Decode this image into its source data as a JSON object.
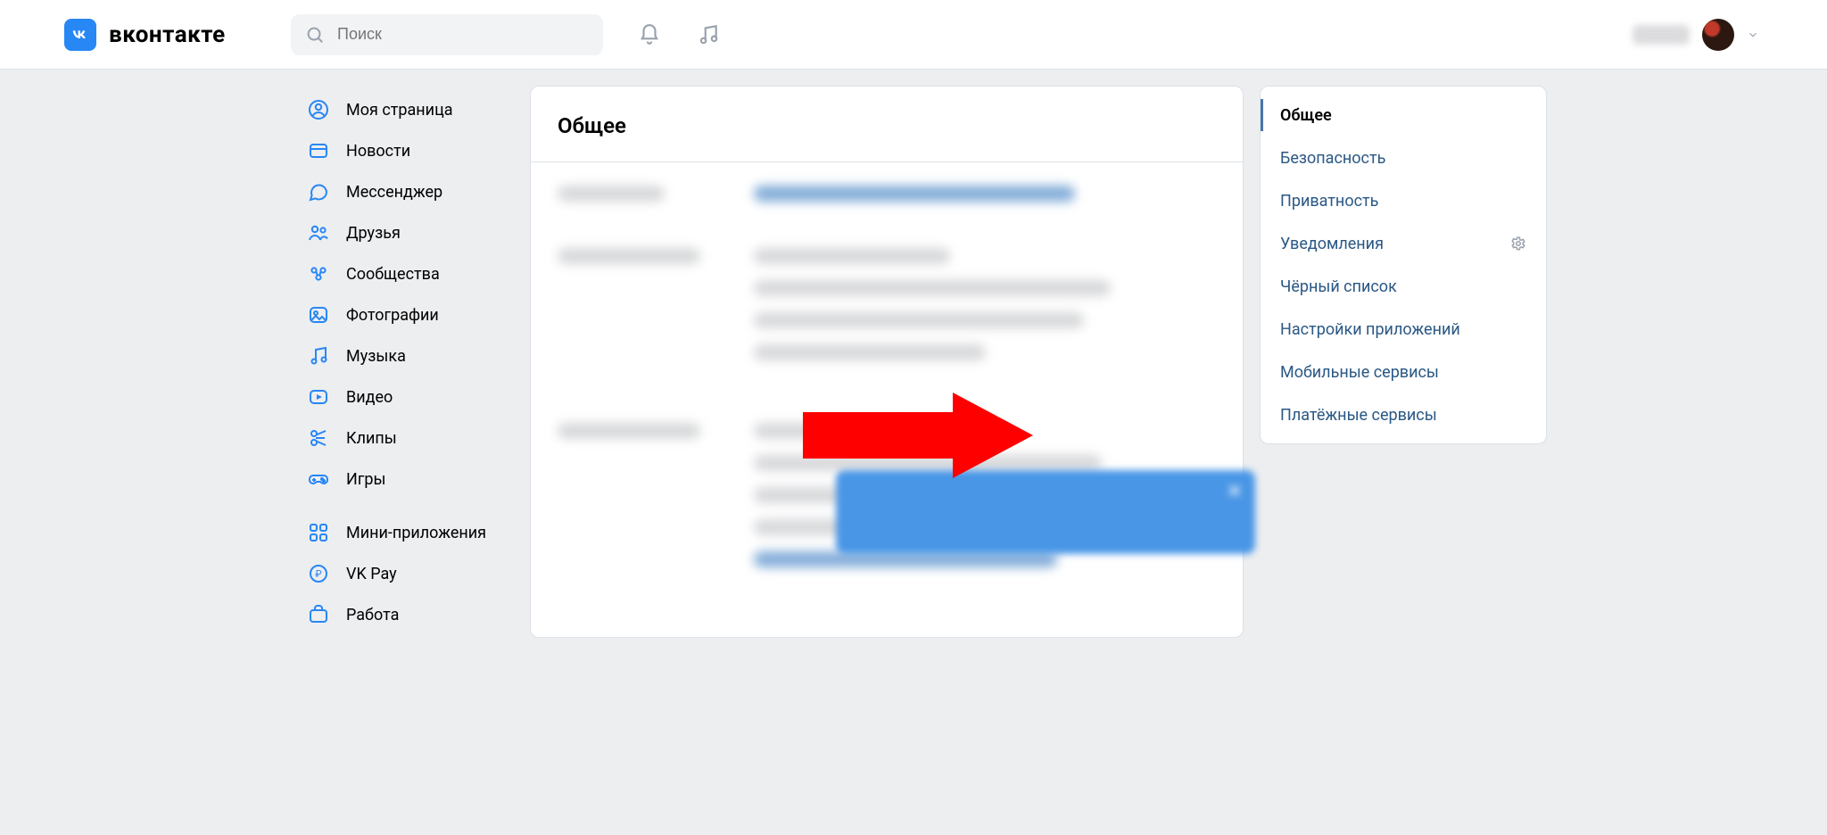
{
  "brand": {
    "name": "вконтакте",
    "logo_letters": "VK"
  },
  "search": {
    "placeholder": "Поиск"
  },
  "left_nav": [
    {
      "key": "profile",
      "label": "Моя страница"
    },
    {
      "key": "news",
      "label": "Новости"
    },
    {
      "key": "messenger",
      "label": "Мессенджер"
    },
    {
      "key": "friends",
      "label": "Друзья"
    },
    {
      "key": "communities",
      "label": "Сообщества"
    },
    {
      "key": "photos",
      "label": "Фотографии"
    },
    {
      "key": "music",
      "label": "Музыка"
    },
    {
      "key": "video",
      "label": "Видео"
    },
    {
      "key": "clips",
      "label": "Клипы"
    },
    {
      "key": "games",
      "label": "Игры"
    }
  ],
  "left_nav_extra": [
    {
      "key": "miniapps",
      "label": "Мини-приложения"
    },
    {
      "key": "vkpay",
      "label": "VK Pay"
    },
    {
      "key": "work",
      "label": "Работа"
    }
  ],
  "main": {
    "title": "Общее"
  },
  "settings_sidebar": [
    {
      "key": "general",
      "label": "Общее",
      "active": true
    },
    {
      "key": "security",
      "label": "Безопасность",
      "active": false
    },
    {
      "key": "privacy",
      "label": "Приватность",
      "active": false
    },
    {
      "key": "notifications",
      "label": "Уведомления",
      "active": false,
      "gear": true
    },
    {
      "key": "blacklist",
      "label": "Чёрный список",
      "active": false
    },
    {
      "key": "apps",
      "label": "Настройки приложений",
      "active": false
    },
    {
      "key": "mobile",
      "label": "Мобильные сервисы",
      "active": false
    },
    {
      "key": "payments",
      "label": "Платёжные сервисы",
      "active": false
    }
  ],
  "annotation": {
    "arrow_target": "payments"
  }
}
